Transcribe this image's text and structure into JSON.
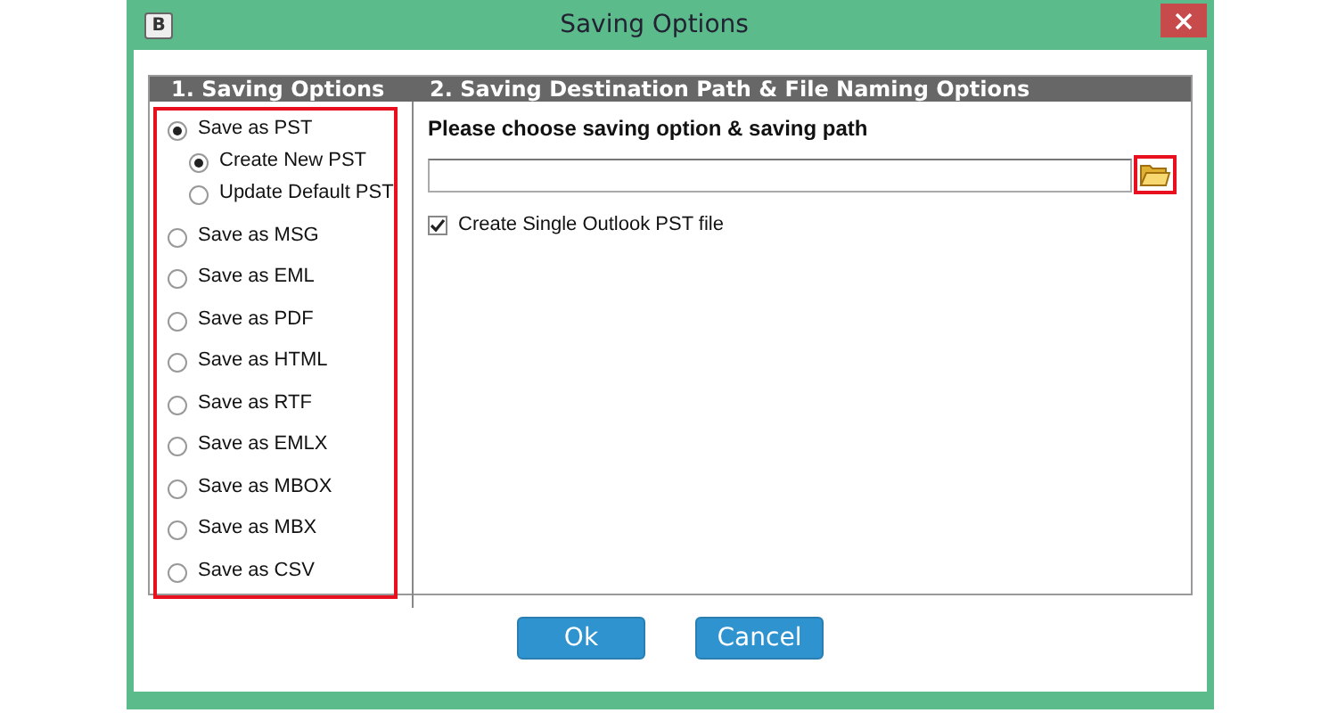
{
  "window": {
    "title": "Saving Options",
    "app_icon": "B"
  },
  "panel_headers": [
    "1. Saving Options",
    "2. Saving Destination Path & File Naming Options"
  ],
  "saving_options": [
    {
      "label": "Save as PST",
      "selected": true,
      "children": [
        {
          "label": "Create New PST",
          "selected": true
        },
        {
          "label": "Update Default PST",
          "selected": false
        }
      ]
    },
    {
      "label": "Save as MSG",
      "selected": false
    },
    {
      "label": "Save as EML",
      "selected": false
    },
    {
      "label": "Save as PDF",
      "selected": false
    },
    {
      "label": "Save as HTML",
      "selected": false
    },
    {
      "label": "Save as RTF",
      "selected": false
    },
    {
      "label": "Save as EMLX",
      "selected": false
    },
    {
      "label": "Save as MBOX",
      "selected": false
    },
    {
      "label": "Save as MBX",
      "selected": false
    },
    {
      "label": "Save as CSV",
      "selected": false
    }
  ],
  "destination": {
    "prompt": "Please choose saving option & saving path",
    "checkbox": {
      "label": "Create Single Outlook PST file",
      "checked": true
    }
  },
  "buttons": [
    "Ok",
    "Cancel"
  ]
}
